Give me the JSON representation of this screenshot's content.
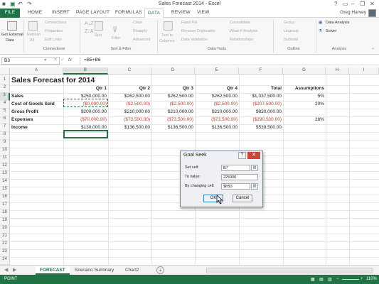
{
  "window": {
    "title": "Sales Forecast 2014 - Excel",
    "user": "Greg Harvey"
  },
  "tabs": [
    {
      "label": "FILE"
    },
    {
      "label": "HOME"
    },
    {
      "label": "INSERT"
    },
    {
      "label": "PAGE LAYOUT"
    },
    {
      "label": "FORMULAS"
    },
    {
      "label": "DATA"
    },
    {
      "label": "REVIEW"
    },
    {
      "label": "VIEW"
    }
  ],
  "ribbon": {
    "get_external": "Get External",
    "get_external2": "Data",
    "refresh": "Refresh",
    "refresh2": "All",
    "connections": "Connections",
    "properties": "Properties",
    "edit_links": "Edit Links",
    "group_connections": "Connections",
    "sort": "Sort",
    "filter": "Filter",
    "clear": "Clear",
    "reapply": "Reapply",
    "advanced": "Advanced",
    "group_sortfilter": "Sort & Filter",
    "text_to": "Text to",
    "columns": "Columns",
    "flash_fill": "Flash Fill",
    "remove_dup": "Remove Duplicates",
    "data_validation": "Data Validation",
    "consolidate": "Consolidate",
    "what_if": "What-If Analysis",
    "relationships": "Relationships",
    "group_datatools": "Data Tools",
    "group_btn": "Group",
    "ungroup": "Ungroup",
    "subtotal": "Subtotal",
    "group_outline": "Outline",
    "data_analysis": "Data Analysis",
    "solver": "Solver",
    "group_analysis": "Analysis"
  },
  "formula_bar": {
    "name_box": "B3",
    "fx": "fx",
    "formula": "=B5+B6"
  },
  "columns": [
    "A",
    "B",
    "C",
    "D",
    "E",
    "F",
    "G",
    "H",
    "I"
  ],
  "rows": [
    "1",
    "2",
    "3",
    "4",
    "5",
    "6",
    "7",
    "8",
    "9",
    "10",
    "11",
    "12",
    "13",
    "14",
    "15",
    "16",
    "17",
    "18",
    "19",
    "20",
    "21",
    "22",
    "23",
    "24"
  ],
  "sheet": {
    "title": "Sales Forecast for 2014",
    "headers": [
      "Qtr 1",
      "Qtr 2",
      "Qtr 3",
      "Qtr 4",
      "Total",
      "Assumptions"
    ],
    "rows": [
      {
        "label": "Sales",
        "values": [
          "$250,000.00",
          "$262,500.00",
          "$262,500.00",
          "$262,500.00",
          "$1,037,500.00"
        ],
        "assumption": "5%"
      },
      {
        "label": "Cost of Goods Sold",
        "values": [
          "($0,000.00)",
          "($2,500.00)",
          "($2,500.00)",
          "($2,500.00)",
          "($207,500.00)"
        ],
        "assumption": "20%"
      },
      {
        "label": "Gross Profit",
        "values": [
          "$200,000.00",
          "$210,000.00",
          "$210,000.00",
          "$210,000.00",
          "$830,000.00"
        ],
        "assumption": ""
      },
      {
        "label": "Expenses",
        "values": [
          "($70,000.00)",
          "($73,500.00)",
          "($73,500.00)",
          "($73,500.00)",
          "($290,500.00)"
        ],
        "assumption": "28%"
      },
      {
        "label": "Income",
        "values": [
          "$130,000.00",
          "$136,500.00",
          "$136,500.00",
          "$136,500.00",
          "$539,500.00"
        ],
        "assumption": ""
      }
    ]
  },
  "dialog": {
    "title": "Goal Seek",
    "help": "?",
    "close": "✕",
    "set_cell_label": "Set cell:",
    "set_cell_value": "B7",
    "to_value_label": "To value:",
    "to_value_value": "225000",
    "changing_label": "By changing cell:",
    "changing_value": "$B$3",
    "ok": "OK",
    "cancel": "Cancel"
  },
  "sheet_tabs": [
    {
      "label": "FORECAST"
    },
    {
      "label": "Scenario Summary"
    },
    {
      "label": "Chart2"
    }
  ],
  "status": {
    "mode": "POINT",
    "zoom": "110%"
  }
}
